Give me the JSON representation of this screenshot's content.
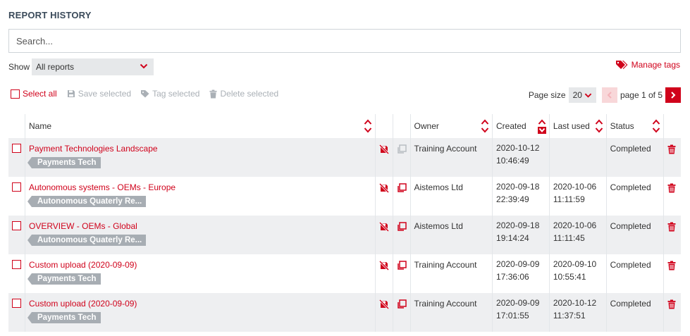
{
  "title": "REPORT HISTORY",
  "search": {
    "placeholder": "Search..."
  },
  "show": {
    "label": "Show",
    "value": "All reports"
  },
  "manage_tags": "Manage tags",
  "toolbar": {
    "select_all": "Select all",
    "save_selected": "Save selected",
    "tag_selected": "Tag selected",
    "delete_selected": "Delete selected"
  },
  "pager": {
    "page_size_label": "Page size",
    "page_size": "20",
    "page_text": "page 1 of 5"
  },
  "columns": {
    "name": "Name",
    "owner": "Owner",
    "created": "Created",
    "last_used": "Last used",
    "status": "Status"
  },
  "colors": {
    "accent": "#d0021b",
    "shade": "#eeeff1",
    "tag": "#a7adb3"
  },
  "rows": [
    {
      "name": "Payment Technologies Landscape",
      "tag": "Payments Tech",
      "owner": "Training Account",
      "created_date": "2020-10-12",
      "created_time": "10:46:49",
      "used_date": "",
      "used_time": "",
      "status": "Completed"
    },
    {
      "name": "Autonomous systems - OEMs - Europe",
      "tag": "Autonomous Quaterly Re...",
      "owner": "Aistemos Ltd",
      "created_date": "2020-09-18",
      "created_time": "22:39:49",
      "used_date": "2020-10-06",
      "used_time": "11:11:59",
      "status": "Completed"
    },
    {
      "name": "OVERVIEW - OEMs - Global",
      "tag": "Autonomous Quaterly Re...",
      "owner": "Aistemos Ltd",
      "created_date": "2020-09-18",
      "created_time": "19:14:24",
      "used_date": "2020-10-06",
      "used_time": "11:11:45",
      "status": "Completed"
    },
    {
      "name": "Custom upload (2020-09-09)",
      "tag": "Payments Tech",
      "owner": "Training Account",
      "created_date": "2020-09-09",
      "created_time": "17:36:06",
      "used_date": "2020-09-10",
      "used_time": "10:55:41",
      "status": "Completed"
    },
    {
      "name": "Custom upload (2020-09-09)",
      "tag": "Payments Tech",
      "owner": "Training Account",
      "created_date": "2020-09-09",
      "created_time": "17:01:55",
      "used_date": "2020-10-12",
      "used_time": "11:37:51",
      "status": "Completed"
    }
  ]
}
